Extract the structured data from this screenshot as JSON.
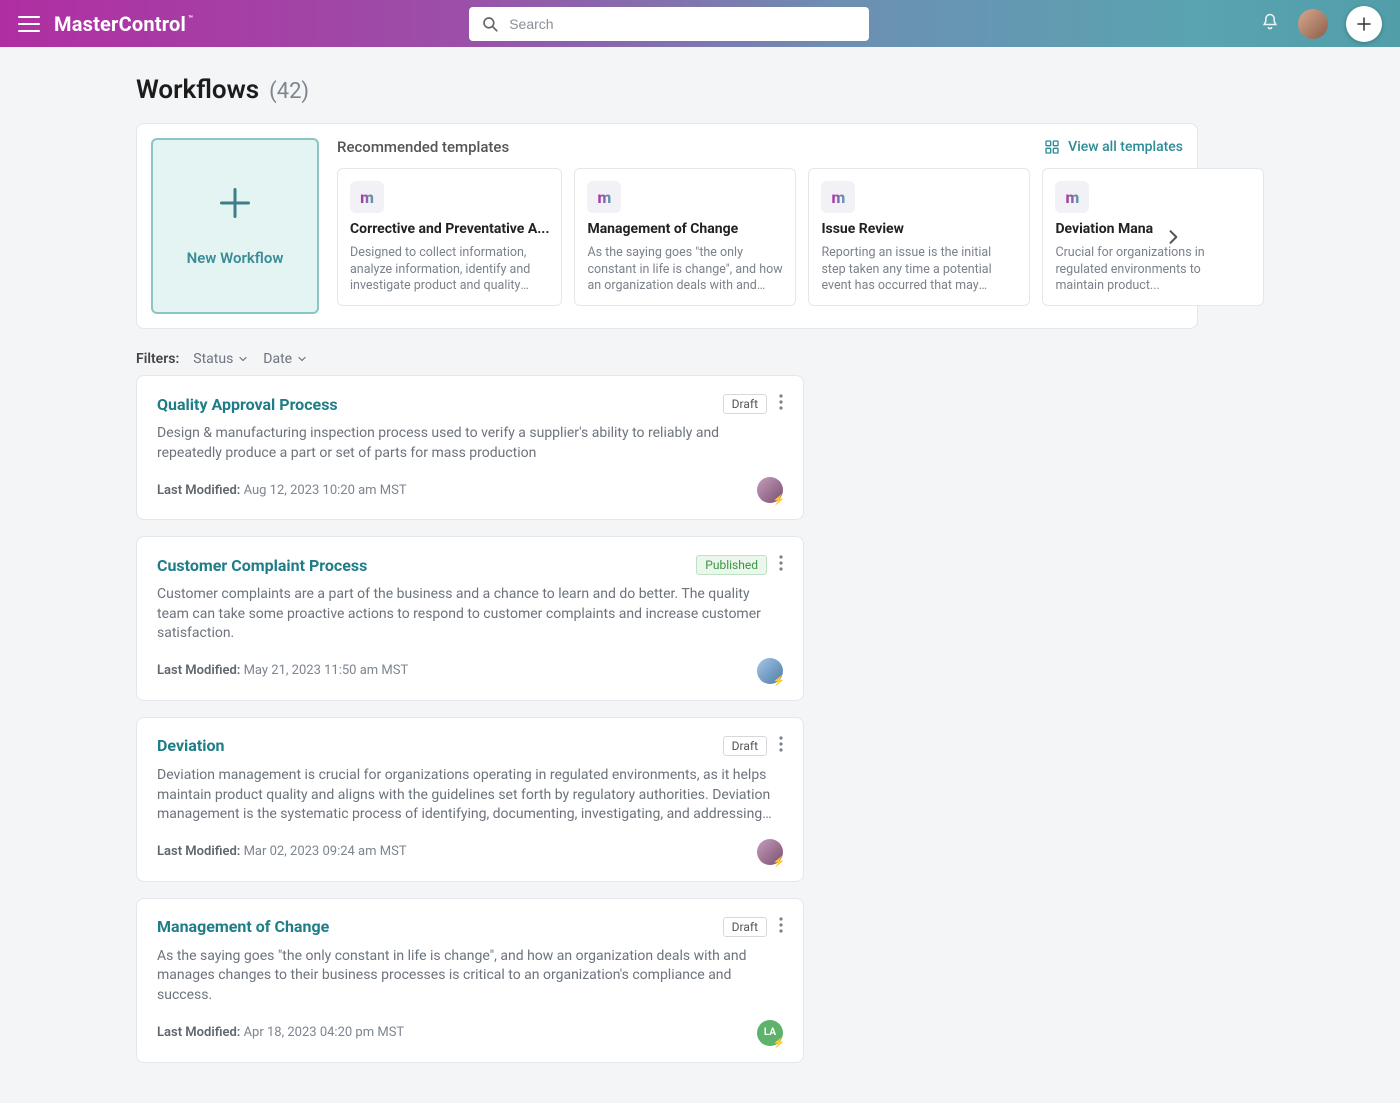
{
  "header": {
    "brand": "MasterControl",
    "search_placeholder": "Search"
  },
  "page": {
    "title": "Workflows",
    "count": "(42)"
  },
  "templates": {
    "new_label": "New Workflow",
    "section_title": "Recommended templates",
    "view_all": "View all templates",
    "items": [
      {
        "title": "Corrective and Preventative A...",
        "desc": "Designed to collect information, analyze information, identify and investigate product and quality prob..."
      },
      {
        "title": "Management of Change",
        "desc": "As the saying goes \"the only constant in life is change\", and how an organization deals with and manage..."
      },
      {
        "title": "Issue Review",
        "desc": "Reporting an issue is the initial step taken any time a potential event has occurred that may impact the qualit..."
      },
      {
        "title": "Deviation Mana",
        "desc": "Crucial for organizations in regulated environments to maintain product..."
      }
    ]
  },
  "filters": {
    "label": "Filters:",
    "status": "Status",
    "date": "Date"
  },
  "workflows": [
    {
      "title": "Quality Approval Process",
      "status": "Draft",
      "status_class": "",
      "desc": "Design & manufacturing inspection process used to verify a supplier's ability to reliably and repeatedly produce a part or set of parts for mass production",
      "last_modified": "Aug 12, 2023 10:20 am MST",
      "avatar_class": "",
      "avatar_text": "",
      "bolt_class": "pink"
    },
    {
      "title": "Customer Complaint Process",
      "status": "Published",
      "status_class": "badge-published",
      "desc": "Customer complaints are a part of the business and a chance to learn and do better. The quality team can take some proactive actions to respond to customer complaints and increase customer satisfaction.",
      "last_modified": "May 21, 2023 11:50 am MST",
      "avatar_class": "blue",
      "avatar_text": "",
      "bolt_class": "blue"
    },
    {
      "title": "Deviation",
      "status": "Draft",
      "status_class": "",
      "desc": "Deviation management is crucial for organizations operating in regulated environments, as it helps maintain product quality and aligns with the guidelines set forth by regulatory authorities. Deviation management is the systematic process of identifying, documenting, investigating, and addressing any unexpected or unplanned...",
      "last_modified": "Mar 02, 2023 09:24 am MST",
      "avatar_class": "",
      "avatar_text": "",
      "bolt_class": "pink"
    },
    {
      "title": "Management of Change",
      "status": "Draft",
      "status_class": "",
      "desc": "As the saying goes \"the only constant in life is change\", and how an organization deals with and manages changes to their business processes is critical to an organization's compliance and success.",
      "last_modified": "Apr 18, 2023 04:20 pm MST",
      "avatar_class": "green",
      "avatar_text": "LA",
      "bolt_class": "green"
    }
  ],
  "labels": {
    "last_modified": "Last Modified:"
  }
}
